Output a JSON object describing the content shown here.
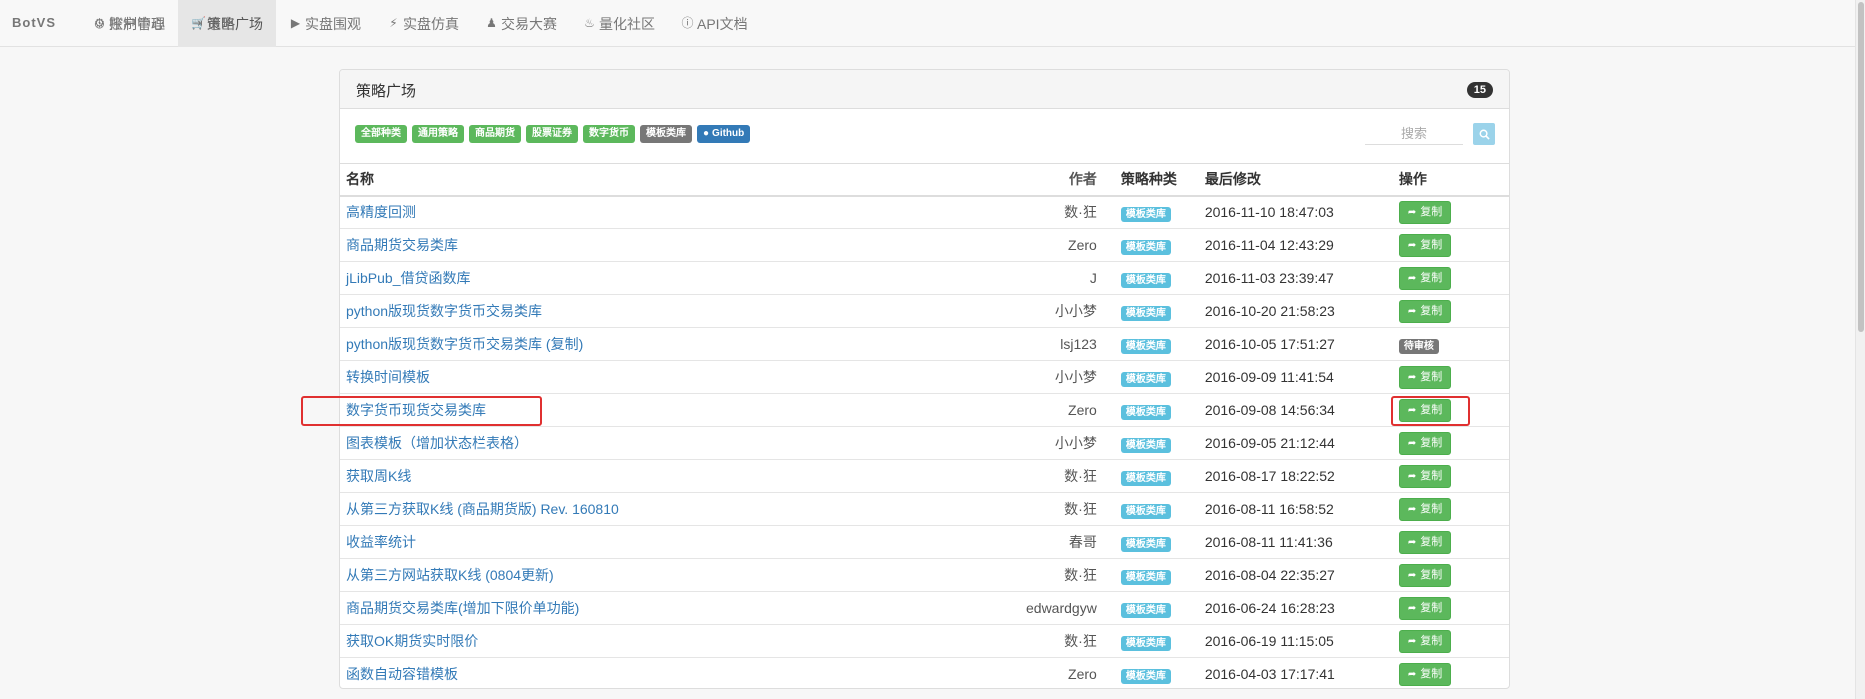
{
  "nav": {
    "brand": "BotVS",
    "items": [
      {
        "icon": "clock-icon",
        "glyph": "◷",
        "label": "控制中心"
      },
      {
        "icon": "cart-icon",
        "glyph": "🛒",
        "label": "策略广场",
        "active": true
      },
      {
        "icon": "play-circle-icon",
        "glyph": "▶",
        "label": "实盘围观"
      },
      {
        "icon": "bolt-icon",
        "glyph": "⚡",
        "label": "实盘仿真"
      },
      {
        "icon": "trophy-icon",
        "glyph": "♟",
        "label": "交易大赛"
      },
      {
        "icon": "fire-icon",
        "glyph": "♨",
        "label": "量化社区"
      },
      {
        "icon": "info-icon",
        "glyph": "ⓘ",
        "label": "API文档"
      }
    ],
    "right": [
      {
        "icon": "gear-icon",
        "glyph": "⚙",
        "label": "账户管理"
      },
      {
        "icon": "sign-out-icon",
        "glyph": "⇥",
        "label": "退出"
      }
    ]
  },
  "panel": {
    "title": "策略广场",
    "count": "15",
    "filters": [
      {
        "label": "全部种类",
        "color": "green"
      },
      {
        "label": "通用策略",
        "color": "green"
      },
      {
        "label": "商品期货",
        "color": "green"
      },
      {
        "label": "股票证券",
        "color": "green"
      },
      {
        "label": "数字货币",
        "color": "green"
      },
      {
        "label": "模板类库",
        "color": "gray"
      },
      {
        "label": "Github",
        "color": "blue",
        "icon": "github-icon"
      }
    ],
    "search_placeholder": "搜索"
  },
  "table": {
    "headers": {
      "name": "名称",
      "author": "作者",
      "category": "策略种类",
      "modified": "最后修改",
      "action": "操作"
    },
    "copy_label": "复制",
    "pending_label": "待审核",
    "rows": [
      {
        "name": "高精度回测",
        "author": "数·狂",
        "category": "模板类库",
        "modified": "2016-11-10 18:47:03",
        "status": "copy"
      },
      {
        "name": "商品期货交易类库",
        "author": "Zero",
        "category": "模板类库",
        "modified": "2016-11-04 12:43:29",
        "status": "copy"
      },
      {
        "name": "jLibPub_借贷函数库",
        "author": "J",
        "category": "模板类库",
        "modified": "2016-11-03 23:39:47",
        "status": "copy"
      },
      {
        "name": "python版现货数字货币交易类库",
        "author": "小小梦",
        "category": "模板类库",
        "modified": "2016-10-20 21:58:23",
        "status": "copy"
      },
      {
        "name": "python版现货数字货币交易类库 (复制)",
        "author": "lsj123",
        "category": "模板类库",
        "modified": "2016-10-05 17:51:27",
        "status": "pending"
      },
      {
        "name": "转换时间模板",
        "author": "小小梦",
        "category": "模板类库",
        "modified": "2016-09-09 11:41:54",
        "status": "copy"
      },
      {
        "name": "数字货币现货交易类库",
        "author": "Zero",
        "category": "模板类库",
        "modified": "2016-09-08 14:56:34",
        "status": "copy",
        "highlighted": true
      },
      {
        "name": "图表模板（增加状态栏表格）",
        "author": "小小梦",
        "category": "模板类库",
        "modified": "2016-09-05 21:12:44",
        "status": "copy"
      },
      {
        "name": "获取周K线",
        "author": "数·狂",
        "category": "模板类库",
        "modified": "2016-08-17 18:22:52",
        "status": "copy"
      },
      {
        "name": "从第三方获取K线 (商品期货版) Rev. 160810",
        "author": "数·狂",
        "category": "模板类库",
        "modified": "2016-08-11 16:58:52",
        "status": "copy"
      },
      {
        "name": "收益率统计",
        "author": "春哥",
        "category": "模板类库",
        "modified": "2016-08-11 11:41:36",
        "status": "copy"
      },
      {
        "name": "从第三方网站获取K线 (0804更新)",
        "author": "数·狂",
        "category": "模板类库",
        "modified": "2016-08-04 22:35:27",
        "status": "copy"
      },
      {
        "name": "商品期货交易类库(增加下限价单功能)",
        "author": "edwardgyw",
        "category": "模板类库",
        "modified": "2016-06-24 16:28:23",
        "status": "copy"
      },
      {
        "name": "获取OK期货实时限价",
        "author": "数·狂",
        "category": "模板类库",
        "modified": "2016-06-19 11:15:05",
        "status": "copy"
      },
      {
        "name": "函数自动容错模板",
        "author": "Zero",
        "category": "模板类库",
        "modified": "2016-04-03 17:17:41",
        "status": "copy"
      }
    ]
  }
}
